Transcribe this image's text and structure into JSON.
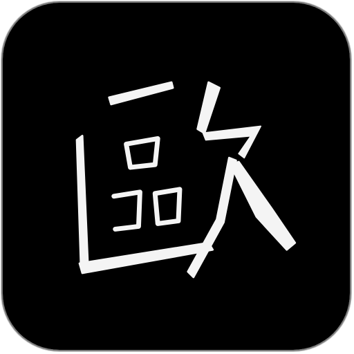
{
  "icon": {
    "glyph": "歐",
    "background_color": "#000000",
    "glyph_color": "#f4f4f4",
    "border_color": "#7a7a7a"
  }
}
